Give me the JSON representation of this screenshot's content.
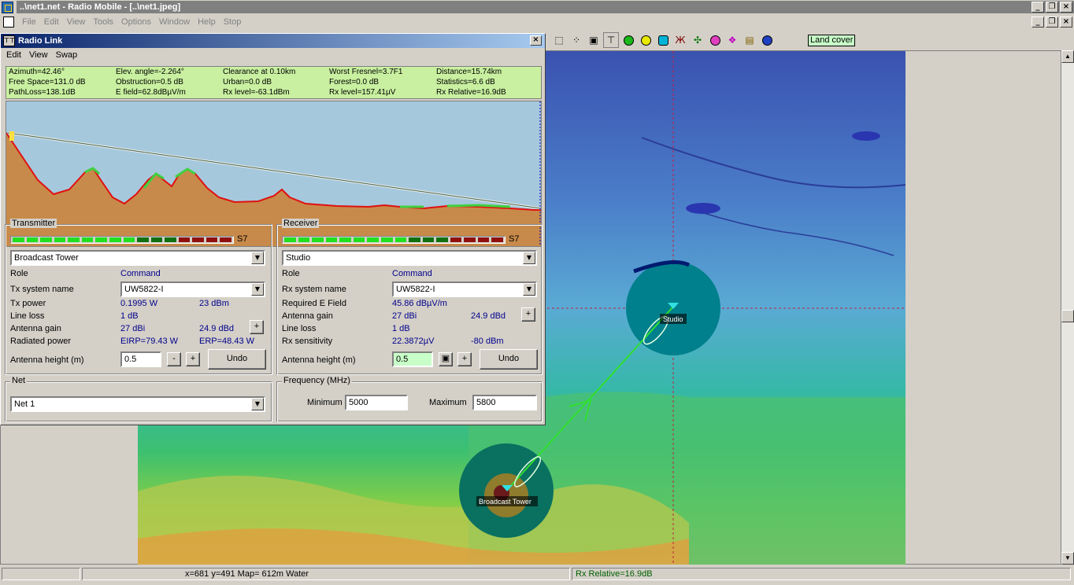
{
  "window": {
    "title": "..\\net1.net - Radio Mobile - [..\\net1.jpeg]",
    "min": "_",
    "restore": "❐",
    "close": "×"
  },
  "menu": [
    "File",
    "Edit",
    "View",
    "Tools",
    "Options",
    "Window",
    "Help",
    "Stop"
  ],
  "toolbar": {
    "landcover_label": "Land cover"
  },
  "map": {
    "studio_label": "Studio",
    "tower_label": "Broadcast Tower"
  },
  "status": {
    "left": "",
    "coords": "x=681 y=491 Map= 612m Water",
    "right": "Rx Relative=16.9dB"
  },
  "radiolink": {
    "title": "Radio Link",
    "close": "×",
    "menu": [
      "Edit",
      "View",
      "Swap"
    ],
    "stats": [
      [
        "Azimuth=42.46°",
        "Elev. angle=-2.264°",
        "Clearance at 0.10km",
        "Worst Fresnel=3.7F1",
        "Distance=15.74km"
      ],
      [
        "Free Space=131.0 dB",
        "Obstruction=0.5 dB",
        "Urban=0.0 dB",
        "Forest=0.0 dB",
        "Statistics=6.6 dB"
      ],
      [
        "PathLoss=138.1dB",
        "E field=62.8dBµV/m",
        "Rx level=-63.1dBm",
        "Rx level=157.41µV",
        "Rx Relative=16.9dB"
      ]
    ],
    "transmitter": {
      "group_label": "Transmitter",
      "s_label": "S7",
      "unit": "Broadcast Tower",
      "role_label": "Role",
      "role_value": "Command",
      "system_label": "Tx system name",
      "system_value": "UW5822-I",
      "power_label": "Tx power",
      "power_w": "0.1995 W",
      "power_dbm": "23 dBm",
      "lineloss_label": "Line loss",
      "lineloss_value": "1 dB",
      "gain_label": "Antenna gain",
      "gain_dbi": "27 dBi",
      "gain_dbd": "24.9 dBd",
      "radiated_label": "Radiated power",
      "eirp": "EIRP=79.43 W",
      "erp": "ERP=48.43 W",
      "height_label": "Antenna height (m)",
      "height_value": "0.5",
      "minus": "-",
      "plus": "+",
      "undo": "Undo"
    },
    "receiver": {
      "group_label": "Receiver",
      "s_label": "S7",
      "unit": "Studio",
      "role_label": "Role",
      "role_value": "Command",
      "system_label": "Rx system name",
      "system_value": "UW5822-I",
      "efield_label": "Required E Field",
      "efield_value": "45.86 dBµV/m",
      "gain_label": "Antenna gain",
      "gain_dbi": "27 dBi",
      "gain_dbd": "24.9 dBd",
      "lineloss_label": "Line loss",
      "lineloss_value": "1 dB",
      "sens_label": "Rx sensitivity",
      "sens_uv": "22.3872µV",
      "sens_dbm": "-80 dBm",
      "height_label": "Antenna height (m)",
      "height_value": "0.5",
      "plus": "+",
      "undo": "Undo"
    },
    "net": {
      "group_label": "Net",
      "value": "Net  1"
    },
    "frequency": {
      "group_label": "Frequency (MHz)",
      "min_label": "Minimum",
      "min_value": "5000",
      "max_label": "Maximum",
      "max_value": "5800"
    },
    "signal_levels": {
      "tx_lit": 12,
      "rx_lit": 12,
      "total": 16
    }
  }
}
